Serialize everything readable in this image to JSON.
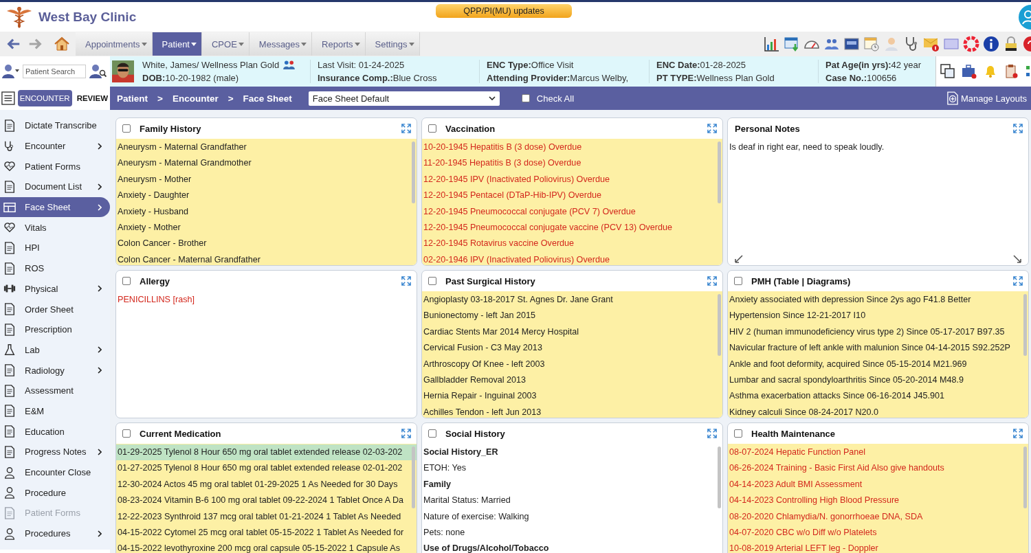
{
  "app": {
    "title": "West Bay Clinic",
    "notice": "QPP/PI(MU) updates"
  },
  "menu": [
    {
      "label": "Appointments",
      "selected": false
    },
    {
      "label": "Patient",
      "selected": true
    },
    {
      "label": "CPOE",
      "selected": false
    },
    {
      "label": "Messages",
      "selected": false
    },
    {
      "label": "Reports",
      "selected": false
    },
    {
      "label": "Settings",
      "selected": false
    }
  ],
  "patient_search": {
    "placeholder": "Patient Search"
  },
  "patient": {
    "columns": [
      [
        {
          "value": "White, James/ Wellness Plan Gold"
        },
        {
          "label": "DOB:",
          "value": "10-20-1982 (male)"
        }
      ],
      [
        {
          "value": "Last Visit: 01-24-2025"
        },
        {
          "label": "Insurance Comp.:",
          "value": "Blue Cross"
        }
      ],
      [
        {
          "label": "ENC Type:",
          "value": "Office Visit"
        },
        {
          "label": "Attending Provider:",
          "value": "Marcus Welby,"
        }
      ],
      [
        {
          "label": "ENC Date:",
          "value": "01-28-2025"
        },
        {
          "label": "PT TYPE:",
          "value": "Wellness Plan Gold"
        }
      ],
      [
        {
          "label": "Pat Age(in yrs):",
          "value": "42 year"
        },
        {
          "label": "Case No.:",
          "value": "100656"
        }
      ]
    ]
  },
  "mode_tabs": [
    {
      "label": "ENCOUNTER",
      "selected": true
    },
    {
      "label": "REVIEW",
      "selected": false
    }
  ],
  "breadcrumb": [
    "Patient",
    ">",
    "Encounter",
    ">",
    "Face Sheet"
  ],
  "layout_select": {
    "value": "Face Sheet Default"
  },
  "check_all": {
    "label": "Check All",
    "checked": false
  },
  "manage_layouts": "Manage Layouts",
  "sidebar": {
    "items": [
      {
        "label": "Dictate Transcribe",
        "has_submenu": false,
        "selected": false,
        "disabled": false
      },
      {
        "label": "Encounter",
        "has_submenu": true,
        "selected": false,
        "disabled": false
      },
      {
        "label": "Patient Forms",
        "has_submenu": false,
        "selected": false,
        "disabled": false
      },
      {
        "label": "Document List",
        "has_submenu": true,
        "selected": false,
        "disabled": false
      },
      {
        "label": "Face Sheet",
        "has_submenu": true,
        "selected": true,
        "disabled": false
      },
      {
        "label": "Vitals",
        "has_submenu": false,
        "selected": false,
        "disabled": false
      },
      {
        "label": "HPI",
        "has_submenu": false,
        "selected": false,
        "disabled": false
      },
      {
        "label": "ROS",
        "has_submenu": false,
        "selected": false,
        "disabled": false
      },
      {
        "label": "Physical",
        "has_submenu": true,
        "selected": false,
        "disabled": false
      },
      {
        "label": "Order Sheet",
        "has_submenu": false,
        "selected": false,
        "disabled": false
      },
      {
        "label": "Prescription",
        "has_submenu": false,
        "selected": false,
        "disabled": false
      },
      {
        "label": "Lab",
        "has_submenu": true,
        "selected": false,
        "disabled": false
      },
      {
        "label": "Radiology",
        "has_submenu": true,
        "selected": false,
        "disabled": false
      },
      {
        "label": "Assessment",
        "has_submenu": false,
        "selected": false,
        "disabled": false
      },
      {
        "label": "E&M",
        "has_submenu": false,
        "selected": false,
        "disabled": false
      },
      {
        "label": "Education",
        "has_submenu": false,
        "selected": false,
        "disabled": false
      },
      {
        "label": "Progress Notes",
        "has_submenu": true,
        "selected": false,
        "disabled": false
      },
      {
        "label": "Encounter Close",
        "has_submenu": false,
        "selected": false,
        "disabled": false
      },
      {
        "label": "Procedure",
        "has_submenu": false,
        "selected": false,
        "disabled": false
      },
      {
        "label": "Patient Forms",
        "has_submenu": false,
        "selected": false,
        "disabled": true
      },
      {
        "label": "Procedures",
        "has_submenu": true,
        "selected": false,
        "disabled": false
      }
    ]
  },
  "panels": [
    {
      "title": "Family History",
      "kind": "list",
      "checked": false,
      "highlighted": true,
      "items": [
        {
          "text": "Aneurysm - Maternal Grandfather",
          "kind": "normal"
        },
        {
          "text": "Aneurysm - Maternal Grandmother",
          "kind": "normal"
        },
        {
          "text": "Aneurysm - Mother",
          "kind": "normal"
        },
        {
          "text": "Anxiety - Daughter",
          "kind": "normal"
        },
        {
          "text": "Anxiety - Husband",
          "kind": "normal"
        },
        {
          "text": "Anxiety - Mother",
          "kind": "normal"
        },
        {
          "text": "Colon Cancer - Brother",
          "kind": "normal"
        },
        {
          "text": "Colon Cancer - Maternal Grandfather",
          "kind": "normal"
        }
      ]
    },
    {
      "title": "Vaccination",
      "kind": "list",
      "checked": false,
      "highlighted": true,
      "items": [
        {
          "text": "10-20-1945 Hepatitis B (3 dose) Overdue",
          "kind": "alert"
        },
        {
          "text": "11-20-1945 Hepatitis B (3 dose) Overdue",
          "kind": "alert"
        },
        {
          "text": "12-20-1945 IPV (Inactivated Poliovirus) Overdue",
          "kind": "alert"
        },
        {
          "text": "12-20-1945 Pentacel (DTaP-Hib-IPV) Overdue",
          "kind": "alert"
        },
        {
          "text": "12-20-1945 Pneumococcal conjugate (PCV 7) Overdue",
          "kind": "alert"
        },
        {
          "text": "12-20-1945 Pneumococcal conjugate vaccine (PCV 13) Overdue",
          "kind": "alert"
        },
        {
          "text": "12-20-1945 Rotavirus vaccine Overdue",
          "kind": "alert"
        },
        {
          "text": "02-20-1946 IPV (Inactivated Poliovirus) Overdue",
          "kind": "alert"
        }
      ]
    },
    {
      "title": "Personal Notes",
      "kind": "note",
      "highlighted": false,
      "items": [
        {
          "text": "Is deaf in right ear, need to speak loudly.",
          "kind": "normal"
        }
      ]
    },
    {
      "title": "Allergy",
      "kind": "list",
      "checked": false,
      "highlighted": false,
      "items": [
        {
          "text": "PENICILLINS [rash]",
          "kind": "alert"
        }
      ]
    },
    {
      "title": "Past Surgical History",
      "kind": "list",
      "checked": false,
      "highlighted": true,
      "items": [
        {
          "text": "Angioplasty 03-18-2017 St. Agnes Dr. Jane Grant",
          "kind": "normal"
        },
        {
          "text": "Bunionectomy - left Jan 2015",
          "kind": "normal"
        },
        {
          "text": "Cardiac Stents Mar 2014 Mercy Hospital",
          "kind": "normal"
        },
        {
          "text": "Cervical Fusion - C3 May 2013",
          "kind": "normal"
        },
        {
          "text": "Arthroscopy Of Knee - left 2003",
          "kind": "normal"
        },
        {
          "text": "Gallbladder Removal 2013",
          "kind": "normal"
        },
        {
          "text": "Hernia Repair - Inguinal 2003",
          "kind": "normal"
        },
        {
          "text": "Achilles Tendon - left Jun 2013",
          "kind": "normal"
        }
      ]
    },
    {
      "title": "PMH (Table | Diagrams)",
      "kind": "list",
      "checked": false,
      "highlighted": true,
      "items": [
        {
          "text": "Anxiety associated with depression Since 2ys ago F41.8 Better",
          "kind": "normal"
        },
        {
          "text": "Hypertension Since 12-21-2017 I10",
          "kind": "normal"
        },
        {
          "text": "HIV 2 (human immunodeficiency virus type 2) Since 05-17-2017 B97.35",
          "kind": "normal"
        },
        {
          "text": "Navicular fracture of left ankle with malunion Since 04-14-2015 S92.252P",
          "kind": "normal"
        },
        {
          "text": "Ankle and foot deformity, acquired Since 05-15-2014 M21.969",
          "kind": "normal"
        },
        {
          "text": "Lumbar and sacral spondyloarthritis Since 05-20-2014 M48.9",
          "kind": "normal"
        },
        {
          "text": "Asthma exacerbation attacks Since 06-16-2014 J45.901",
          "kind": "normal"
        },
        {
          "text": "Kidney calculi Since 08-24-2017 N20.0",
          "kind": "normal"
        }
      ]
    },
    {
      "title": "Current Medication",
      "kind": "list",
      "checked": false,
      "highlighted": true,
      "items": [
        {
          "text": "01-29-2025 Tylenol 8 Hour 650 mg oral tablet extended release 02-03-202",
          "kind": "current"
        },
        {
          "text": "01-27-2025 Tylenol 8 Hour 650 mg oral tablet extended release 02-01-202",
          "kind": "normal"
        },
        {
          "text": "12-30-2024 Actos 45 mg oral tablet 01-29-2025 1 As Needed for 30 Days",
          "kind": "normal"
        },
        {
          "text": "08-23-2024 Vitamin B-6 100 mg oral tablet 09-22-2024 1 Tablet Once A Da",
          "kind": "normal"
        },
        {
          "text": "12-22-2023 Synthroid 137 mcg oral tablet 01-21-2024 1 Tablet As Needed",
          "kind": "normal"
        },
        {
          "text": "04-15-2022 Cytomel 25 mcg oral tablet 05-15-2022 1 Tablet As Needed for",
          "kind": "normal"
        },
        {
          "text": "04-15-2022 levothyroxine 200 mcg oral capsule 05-15-2022 1 Capsule As",
          "kind": "normal"
        }
      ]
    },
    {
      "title": "Social History",
      "kind": "list",
      "checked": false,
      "highlighted": false,
      "items": [
        {
          "text": "Social History_ER",
          "kind": "heading"
        },
        {
          "text": "ETOH: Yes",
          "kind": "normal"
        },
        {
          "text": "Family",
          "kind": "heading"
        },
        {
          "text": "Marital Status: Married",
          "kind": "normal"
        },
        {
          "text": "Nature of exercise: Walking",
          "kind": "normal"
        },
        {
          "text": "Pets: none",
          "kind": "normal"
        },
        {
          "text": "Use of Drugs/Alcohol/Tobacco",
          "kind": "heading"
        }
      ]
    },
    {
      "title": "Health Maintenance",
      "kind": "list",
      "checked": false,
      "highlighted": true,
      "items": [
        {
          "text": "08-07-2024 Hepatic Function Panel",
          "kind": "alert"
        },
        {
          "text": "06-26-2024 Training - Basic First Aid Also give handouts",
          "kind": "alert"
        },
        {
          "text": "04-14-2023 Adult BMI Assessment",
          "kind": "alert"
        },
        {
          "text": "04-14-2023 Controlling High Blood Pressure",
          "kind": "alert"
        },
        {
          "text": "08-20-2020 Chlamydia/N. gonorrhoeae DNA, SDA",
          "kind": "alert"
        },
        {
          "text": "04-07-2020 CBC w/o Diff w/o Platelets",
          "kind": "alert"
        },
        {
          "text": "10-08-2019 Arterial LEFT leg - Doppler",
          "kind": "alert"
        }
      ]
    }
  ]
}
